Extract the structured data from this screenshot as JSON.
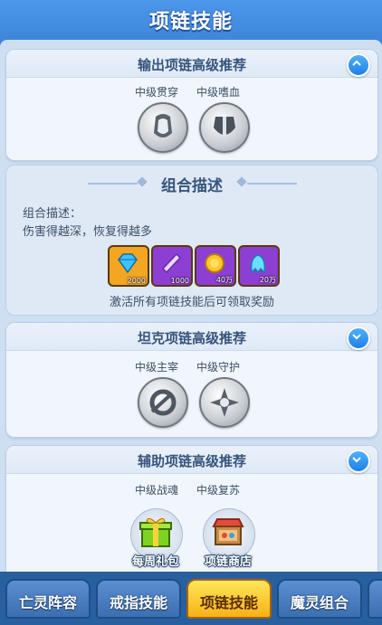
{
  "header": {
    "title": "项链技能"
  },
  "sections": [
    {
      "title": "输出项链高级推荐",
      "toggle": "collapse",
      "skills": [
        {
          "label": "中级贯穿",
          "icon": "warrior-skill-icon"
        },
        {
          "label": "中级嗜血",
          "icon": "armor-skill-icon"
        }
      ]
    },
    {
      "title": "坦克项链高级推荐",
      "toggle": "expand",
      "skills": [
        {
          "label": "中级主宰",
          "icon": "chain-skill-icon"
        },
        {
          "label": "中级守护",
          "icon": "shield-skill-icon"
        }
      ]
    },
    {
      "title": "辅助项链高级推荐",
      "toggle": "expand",
      "skills": [
        {
          "label": "中级战魂",
          "icon": "soul-skill-icon"
        },
        {
          "label": "中级复苏",
          "icon": "revive-skill-icon"
        }
      ]
    }
  ],
  "combo": {
    "title": "组合描述",
    "label": "组合描述：",
    "description": "伤害得越深，恢复得越多",
    "rewards": [
      {
        "amount": "2000",
        "icon": "diamond-icon",
        "color": "#f2a621"
      },
      {
        "amount": "1000",
        "icon": "crystal-icon",
        "color": "#8d3fd3"
      },
      {
        "amount": "40万",
        "icon": "gold-coin-icon",
        "color": "#8d3fd3"
      },
      {
        "amount": "20万",
        "icon": "spirit-icon",
        "color": "#8d3fd3"
      }
    ],
    "note": "激活所有项链技能后可领取奖励"
  },
  "floaters": [
    {
      "label": "每周礼包",
      "icon": "gift-box-icon"
    },
    {
      "label": "项链商店",
      "icon": "shop-icon"
    }
  ],
  "tabs": [
    {
      "label": "亡灵阵容",
      "active": false
    },
    {
      "label": "戒指技能",
      "active": false
    },
    {
      "label": "项链技能",
      "active": true
    },
    {
      "label": "魔灵组合",
      "active": false
    }
  ]
}
